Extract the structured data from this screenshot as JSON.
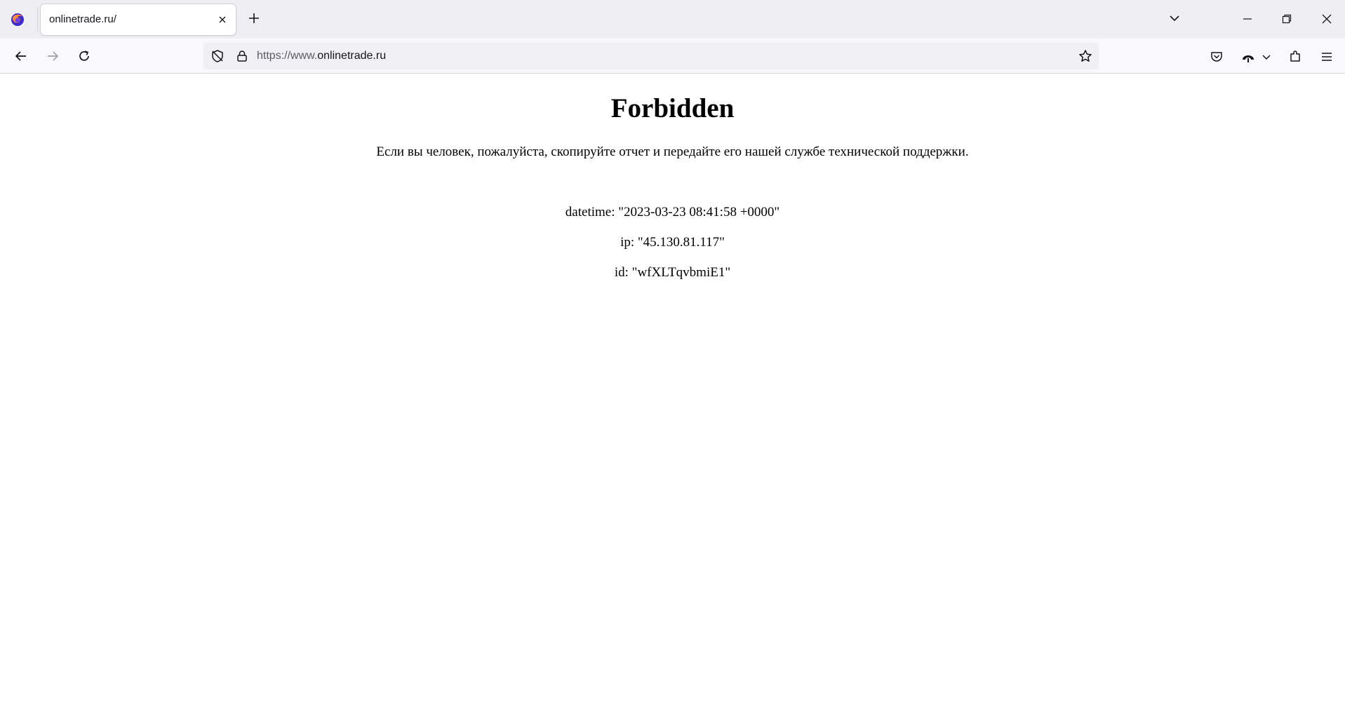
{
  "browser": {
    "tab": {
      "title": "onlinetrade.ru/"
    },
    "urlbar": {
      "scheme_prefix": "https://www.",
      "host": "onlinetrade.ru"
    },
    "icons": {
      "logo": "firefox-icon",
      "tab_close": "close-icon",
      "new_tab": "plus-icon",
      "list_tabs": "chevron-down-icon",
      "minimize": "minimize-icon",
      "restore": "restore-icon",
      "close": "close-icon",
      "back": "arrow-left-icon",
      "forward": "arrow-right-icon",
      "reload": "reload-icon",
      "tracking": "shield-icon",
      "lock": "lock-icon",
      "bookmark": "star-icon",
      "pocket": "pocket-icon",
      "vpn": "vpn-icon",
      "extensions": "puzzle-icon",
      "menu": "hamburger-icon"
    }
  },
  "page": {
    "title": "Forbidden",
    "message": "Если вы человек, пожалуйста, скопируйте отчет и передайте его нашей службе технической поддержки.",
    "datetime_line": "datetime: \"2023-03-23 08:41:58 +0000\"",
    "ip_line": "ip: \"45.130.81.117\"",
    "id_line": "id: \"wfXLTqvbmiE1\""
  }
}
